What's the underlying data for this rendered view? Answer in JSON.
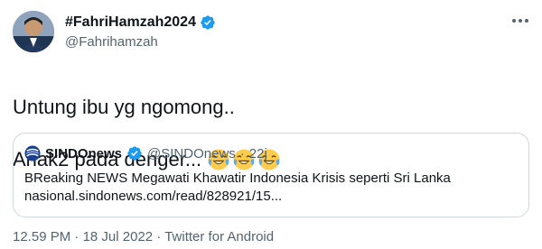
{
  "author": {
    "display_name": "#FahriHamzah2024",
    "handle": "@Fahrihamzah",
    "avatar_icon": "profile-photo",
    "verified_icon": "verified-badge-icon"
  },
  "tweet": {
    "line1": "Untung ibu yg ngomong..",
    "line2": "Anak2 pada denger...",
    "emojis": [
      "😂",
      "😂",
      "😂"
    ]
  },
  "quote": {
    "name": "SINDOnews",
    "handle": "@SINDOnews",
    "separator": "·",
    "time": "22j",
    "headline": "BReaking NEWS Megawati Khawatir Indonesia Krisis seperti Sri Lanka",
    "link": "nasional.sindonews.com/read/828921/15..."
  },
  "footer": {
    "time": "12.59 PM",
    "separator1": "·",
    "date": "18 Jul 2022",
    "separator2": "·",
    "source": "Twitter for Android"
  },
  "colors": {
    "accent": "#1d9bf0",
    "secondary_text": "#536471",
    "border": "#cfd9de"
  }
}
